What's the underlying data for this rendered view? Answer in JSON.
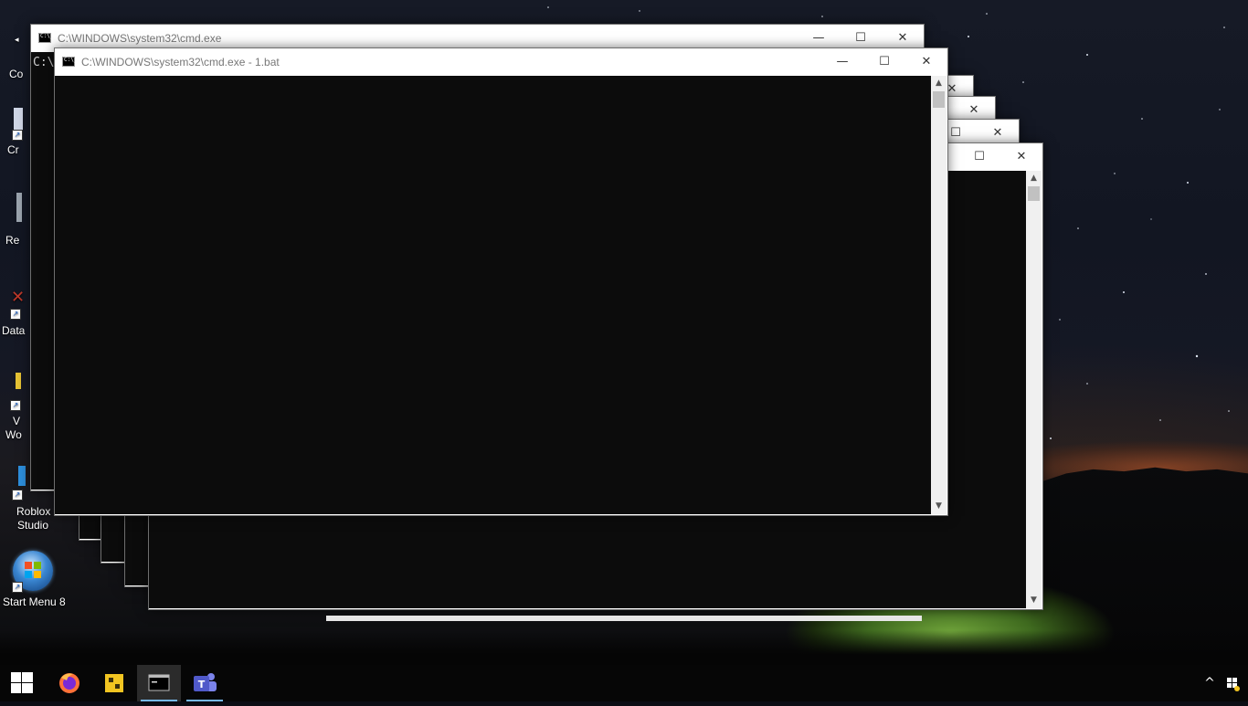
{
  "desktop": {
    "icons": [
      {
        "label": "Co",
        "name": "desktop-icon-computer"
      },
      {
        "label": "Cr",
        "name": "desktop-icon-cr"
      },
      {
        "label": "Re",
        "name": "desktop-icon-recycle"
      },
      {
        "label": "Data",
        "name": "desktop-icon-data"
      },
      {
        "label": "V",
        "name": "desktop-icon-v"
      },
      {
        "label": "Wo",
        "name": "desktop-icon-wo"
      },
      {
        "label": "Roblox",
        "name": "desktop-icon-roblox"
      },
      {
        "label": "Studio",
        "name": "desktop-icon-studio"
      },
      {
        "label": "Start Menu 8",
        "name": "desktop-icon-start-menu-8"
      }
    ]
  },
  "windows": {
    "back": {
      "title": "C:\\WINDOWS\\system32\\cmd.exe",
      "console_text": "C:\\"
    },
    "front": {
      "title": "C:\\WINDOWS\\system32\\cmd.exe - 1.bat",
      "console_text": ""
    },
    "controls": {
      "minimize": "—",
      "maximize": "☐",
      "close": "✕"
    },
    "scroll": {
      "up": "▲",
      "down": "▼"
    }
  },
  "taskbar": {
    "apps": [
      {
        "name": "start-button",
        "icon": "windows-logo-icon"
      },
      {
        "name": "taskbar-firefox",
        "icon": "firefox-icon"
      },
      {
        "name": "taskbar-roblox-studio",
        "icon": "roblox-studio-icon"
      },
      {
        "name": "taskbar-cmd",
        "icon": "cmd-icon"
      },
      {
        "name": "taskbar-teams",
        "icon": "teams-icon"
      }
    ],
    "tray": {
      "chevron": "^"
    }
  },
  "colors": {
    "console_bg": "#0c0c0c",
    "accent": "#76b9ed",
    "teams": "#5059c9",
    "firefox": "#ff7139"
  }
}
